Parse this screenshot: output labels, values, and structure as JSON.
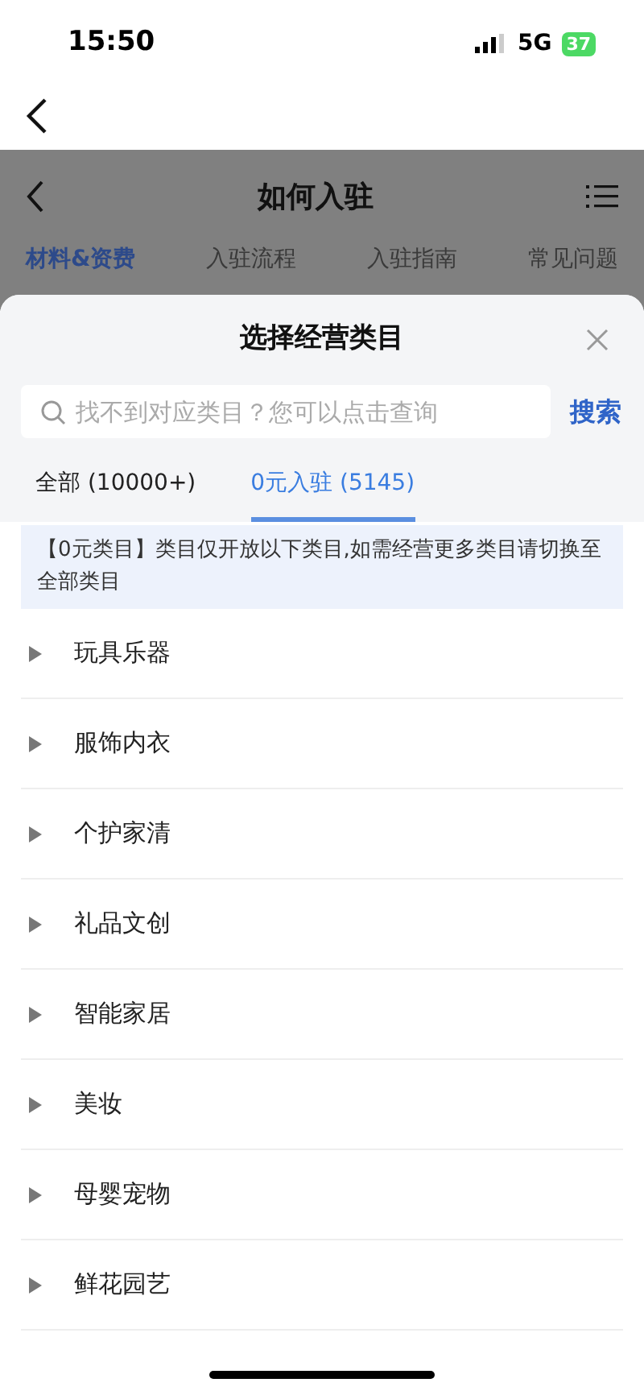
{
  "status_bar": {
    "time": "15:50",
    "network": "5G",
    "battery": "37"
  },
  "page": {
    "title": "如何入驻",
    "tabs": [
      {
        "label": "材料&资费",
        "selected": true
      },
      {
        "label": "入驻流程",
        "selected": false
      },
      {
        "label": "入驻指南",
        "selected": false
      },
      {
        "label": "常见问题",
        "selected": false
      }
    ]
  },
  "sheet": {
    "title": "选择经营类目",
    "search": {
      "placeholder": "找不到对应类目？您可以点击查询",
      "button": "搜索"
    },
    "tabs": [
      {
        "label": "全部 (10000+)",
        "selected": false
      },
      {
        "label": "0元入驻 (5145)",
        "selected": true
      }
    ],
    "notice": "【0元类目】类目仅开放以下类目,如需经营更多类目请切换至全部类目",
    "categories": [
      {
        "label": "玩具乐器",
        "expanded": false
      },
      {
        "label": "服饰内衣",
        "expanded": false
      },
      {
        "label": "个护家清",
        "expanded": false
      },
      {
        "label": "礼品文创",
        "expanded": false
      },
      {
        "label": "智能家居",
        "expanded": false
      },
      {
        "label": "美妆",
        "expanded": false
      },
      {
        "label": "母婴宠物",
        "expanded": false
      },
      {
        "label": "鲜花园艺",
        "expanded": false
      }
    ]
  }
}
